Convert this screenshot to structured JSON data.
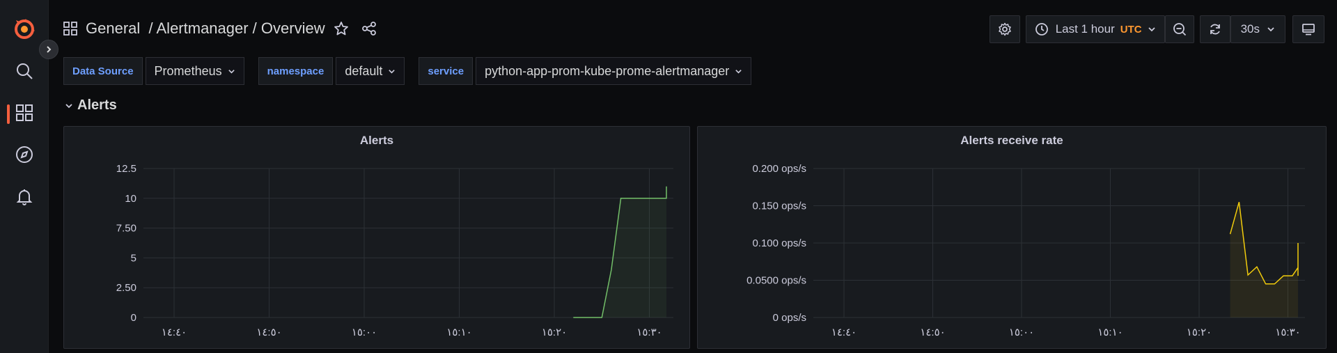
{
  "dashboard": {
    "title": "General  / Alertmanager / Overview"
  },
  "toolbar": {
    "time_range": "Last 1 hour",
    "timezone": "UTC",
    "refresh_interval": "30s"
  },
  "variables": [
    {
      "label": "Data Source",
      "value": "Prometheus"
    },
    {
      "label": "namespace",
      "value": "default"
    },
    {
      "label": "service",
      "value": "python-app-prom-kube-prome-alertmanager"
    }
  ],
  "row": {
    "title": "Alerts"
  },
  "colors": {
    "accent": "#f55f3e",
    "green_series": "#73bf69",
    "yellow_series": "#f2cc0c",
    "var_label": "#6e9fff"
  },
  "panels": [
    {
      "title": "Alerts"
    },
    {
      "title": "Alerts receive rate"
    }
  ],
  "chart_data": [
    {
      "type": "area",
      "title": "Alerts",
      "x_tick_labels": [
        "١٤:٤٠",
        "١٤:٥٠",
        "١٥:٠٠",
        "١٥:١٠",
        "١٥:٢٠",
        "١٥:٣٠"
      ],
      "y_tick_labels": [
        "0",
        "2.50",
        "5",
        "7.50",
        "10",
        "12.5"
      ],
      "ylim": [
        0,
        12.5
      ],
      "xlim": [
        0,
        55
      ],
      "grid": true,
      "series": [
        {
          "color": "#73bf69",
          "x": [
            42,
            45,
            46,
            47,
            51,
            52,
            53.2,
            56
          ],
          "y": [
            0,
            0,
            4,
            10,
            10,
            10,
            11,
            11
          ]
        }
      ]
    },
    {
      "type": "line",
      "title": "Alerts receive rate",
      "x_tick_labels": [
        "١٤:٤٠",
        "١٤:٥٠",
        "١٥:٠٠",
        "١٥:١٠",
        "١٥:٢٠",
        "١٥:٣٠"
      ],
      "y_tick_labels": [
        "0 ops/s",
        "0.0500 ops/s",
        "0.100 ops/s",
        "0.150 ops/s",
        "0.200 ops/s"
      ],
      "ylim": [
        0,
        0.2
      ],
      "xlim": [
        0,
        55
      ],
      "grid": true,
      "series": [
        {
          "color": "#f2cc0c",
          "x": [
            43.5,
            44.5,
            45.5,
            46.5,
            47.5,
            48.5,
            49.5,
            50.5,
            51.5,
            52.5,
            53.5,
            54.5,
            55.5,
            57.5
          ],
          "y": [
            0.112,
            0.155,
            0.057,
            0.068,
            0.045,
            0.045,
            0.056,
            0.056,
            0.067,
            0.056,
            0.09,
            0.1,
            0.1,
            0.1
          ]
        }
      ]
    }
  ]
}
